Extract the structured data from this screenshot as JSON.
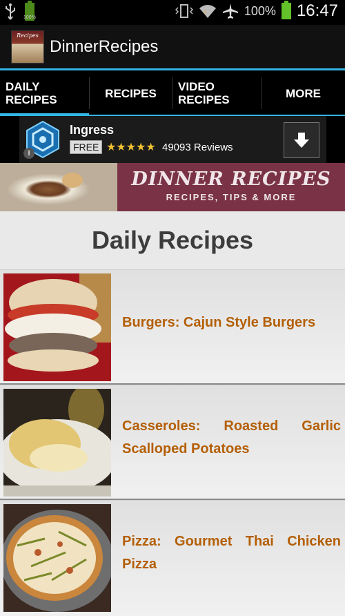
{
  "status_bar": {
    "battery_small_label": "100%",
    "battery_percent": "100%",
    "time": "16:47"
  },
  "action_bar": {
    "logo_text": "Recipes",
    "title": "DinnerRecipes"
  },
  "tabs": [
    {
      "label": "DAILY RECIPES",
      "line1": "DAILY",
      "line2": "RECIPES",
      "active": true
    },
    {
      "label": "RECIPES",
      "line1": "RECIPES",
      "line2": "",
      "active": false
    },
    {
      "label": "VIDEO RECIPES",
      "line1": "VIDEO",
      "line2": "RECIPES",
      "active": false
    },
    {
      "label": "MORE",
      "line1": "MORE",
      "line2": "",
      "active": false
    }
  ],
  "ad": {
    "app_name": "Ingress",
    "price": "FREE",
    "rating": 4.5,
    "stars": "★★★★★",
    "reviews": "49093 Reviews",
    "info_icon": "i"
  },
  "banner": {
    "title": "DINNER RECIPES",
    "subtitle": "RECIPES, TIPS & MORE"
  },
  "content": {
    "heading": "Daily Recipes",
    "items": [
      {
        "title": "Burgers: Cajun Style Burgers",
        "image": "burger-photo"
      },
      {
        "title": "Casseroles: Roasted Garlic Scalloped Potatoes",
        "image": "casserole-photo"
      },
      {
        "title": "Pizza: Gourmet Thai Chicken Pizza",
        "image": "pizza-photo"
      }
    ]
  },
  "colors": {
    "accent": "#33b5e5",
    "item_title": "#b45f06",
    "banner_bg": "#7a3346"
  }
}
